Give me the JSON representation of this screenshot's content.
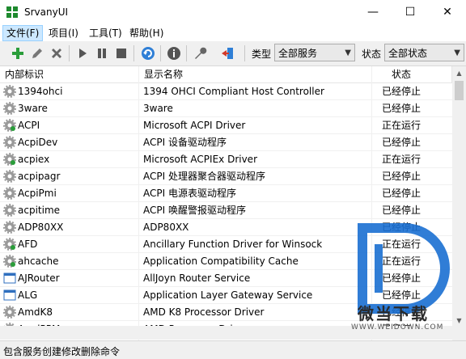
{
  "window": {
    "title": "SrvanyUI",
    "minimize_glyph": "—",
    "maximize_glyph": "☐",
    "close_glyph": "✕"
  },
  "menu": {
    "items": [
      "文件(F)",
      "项目(I)",
      "工具(T)",
      "帮助(H)"
    ]
  },
  "toolbar": {
    "type_label": "类型",
    "type_value": "全部服务",
    "status_label": "状态",
    "status_value": "全部状态",
    "icons": [
      "add-icon",
      "edit-icon",
      "delete-icon",
      "start-icon",
      "pause-icon",
      "stop-icon",
      "refresh-icon",
      "info-icon",
      "wrench-icon",
      "exit-icon"
    ]
  },
  "table": {
    "columns": [
      "内部标识",
      "显示名称",
      "状态"
    ],
    "rows": [
      {
        "id": "1394ohci",
        "name": "1394 OHCI Compliant Host Controller",
        "status": "已经停止",
        "icon": "gear"
      },
      {
        "id": "3ware",
        "name": "3ware",
        "status": "已经停止",
        "icon": "gear"
      },
      {
        "id": "ACPI",
        "name": "Microsoft ACPI Driver",
        "status": "正在运行",
        "icon": "gear-green"
      },
      {
        "id": "AcpiDev",
        "name": "ACPI 设备驱动程序",
        "status": "已经停止",
        "icon": "gear"
      },
      {
        "id": "acpiex",
        "name": "Microsoft ACPIEx Driver",
        "status": "正在运行",
        "icon": "gear-green"
      },
      {
        "id": "acpipagr",
        "name": "ACPI 处理器聚合器驱动程序",
        "status": "已经停止",
        "icon": "gear"
      },
      {
        "id": "AcpiPmi",
        "name": "ACPI 电源表驱动程序",
        "status": "已经停止",
        "icon": "gear"
      },
      {
        "id": "acpitime",
        "name": "ACPI 唤醒警报驱动程序",
        "status": "已经停止",
        "icon": "gear"
      },
      {
        "id": "ADP80XX",
        "name": "ADP80XX",
        "status": "已经停止",
        "icon": "gear"
      },
      {
        "id": "AFD",
        "name": "Ancillary Function Driver for Winsock",
        "status": "正在运行",
        "icon": "gear-green"
      },
      {
        "id": "ahcache",
        "name": "Application Compatibility Cache",
        "status": "正在运行",
        "icon": "gear-green"
      },
      {
        "id": "AJRouter",
        "name": "AllJoyn Router Service",
        "status": "已经停止",
        "icon": "window"
      },
      {
        "id": "ALG",
        "name": "Application Layer Gateway Service",
        "status": "已经停止",
        "icon": "window"
      },
      {
        "id": "AmdK8",
        "name": "AMD K8 Processor Driver",
        "status": "已经停止",
        "icon": "gear"
      },
      {
        "id": "AmdPPM",
        "name": "AMD Processor Driver",
        "status": "已经停止",
        "icon": "gear"
      }
    ]
  },
  "statusbar": {
    "text": "包含服务创建修改删除命令"
  },
  "watermark": {
    "text": "微当下载",
    "url": "WWW.WEIDOWN.COM"
  },
  "colors": {
    "accent": "#1e8a2e",
    "selection": "#cce8ff",
    "watermark": "#1a6fd1"
  }
}
